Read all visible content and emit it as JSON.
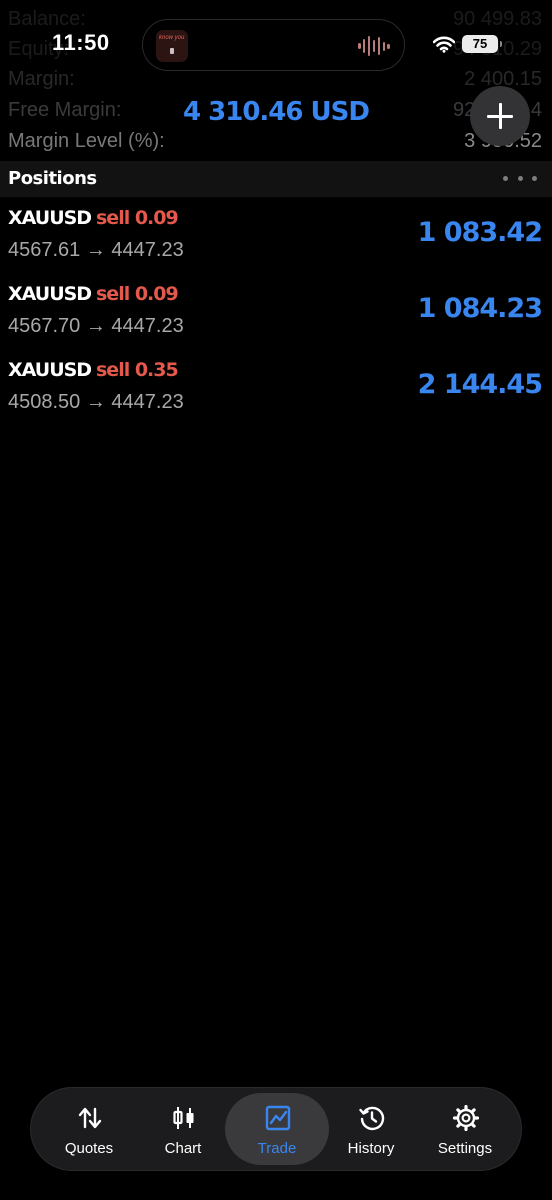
{
  "status_bar": {
    "time": "11:50",
    "battery": "75",
    "now_playing_art_text": "know you"
  },
  "account": {
    "rows": [
      {
        "label": "Balance:",
        "value": "90 499.83"
      },
      {
        "label": "Equity:",
        "value": "94 810.29"
      },
      {
        "label": "Margin:",
        "value": "2 400.15"
      },
      {
        "label": "Free Margin:",
        "value": "92 410.14"
      },
      {
        "label": "Margin Level (%):",
        "value": "3 950.52"
      }
    ],
    "total_profit": "4 310.46 USD"
  },
  "positions": {
    "title": "Positions",
    "items": [
      {
        "symbol": "XAUUSD",
        "side": "sell 0.09",
        "open_price": "4567.61",
        "arrow": "→",
        "current_price": "4447.23",
        "profit": "1 083.42"
      },
      {
        "symbol": "XAUUSD",
        "side": "sell 0.09",
        "open_price": "4567.70",
        "arrow": "→",
        "current_price": "4447.23",
        "profit": "1 084.23"
      },
      {
        "symbol": "XAUUSD",
        "side": "sell 0.35",
        "open_price": "4508.50",
        "arrow": "→",
        "current_price": "4447.23",
        "profit": "2 144.45"
      }
    ]
  },
  "tab_bar": {
    "active": "Trade",
    "tabs": [
      {
        "label": "Quotes",
        "icon": "sort-arrows-icon"
      },
      {
        "label": "Chart",
        "icon": "candlestick-icon"
      },
      {
        "label": "Trade",
        "icon": "trade-chart-icon"
      },
      {
        "label": "History",
        "icon": "history-clock-icon"
      },
      {
        "label": "Settings",
        "icon": "gear-icon"
      }
    ]
  },
  "colors": {
    "accent_blue": "#3a86f0",
    "sell_red": "#e5594c",
    "background": "#000000"
  }
}
